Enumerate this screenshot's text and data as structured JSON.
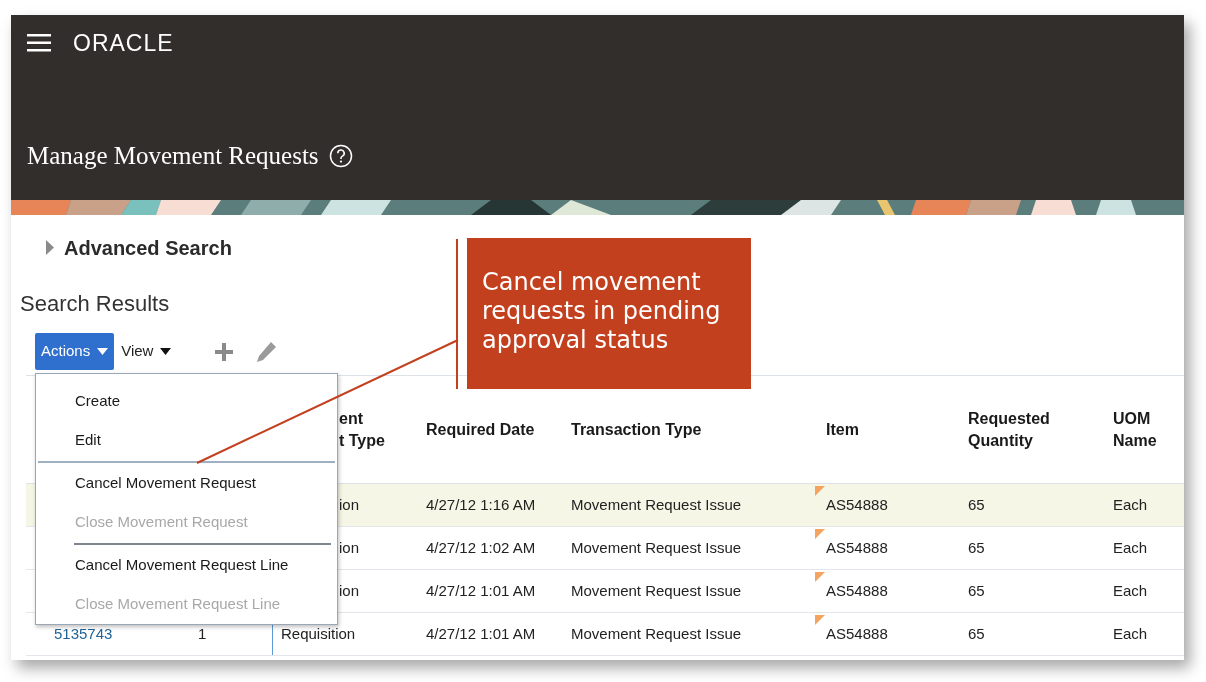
{
  "header": {
    "logo": "ORACLE",
    "page_title": "Manage Movement Requests"
  },
  "advanced_search": {
    "label": "Advanced Search",
    "expanded": false
  },
  "results": {
    "title": "Search Results",
    "actions_button": "Actions",
    "view_button": "View"
  },
  "actions_menu": {
    "items": [
      {
        "kind": "item",
        "label": "Create",
        "disabled": false
      },
      {
        "kind": "item",
        "label": "Edit",
        "disabled": false
      },
      {
        "kind": "separator",
        "inset": false
      },
      {
        "kind": "item",
        "label": "Cancel Movement Request",
        "disabled": false
      },
      {
        "kind": "item",
        "label": "Close Movement Request",
        "disabled": true
      },
      {
        "kind": "separator",
        "inset": true
      },
      {
        "kind": "item",
        "label": "Cancel Movement Request Line",
        "disabled": false
      },
      {
        "kind": "item",
        "label": "Close Movement Request Line",
        "disabled": true
      }
    ]
  },
  "table": {
    "columns": [
      {
        "label": "ent\nt Type"
      },
      {
        "label": "Required Date"
      },
      {
        "label": "Transaction Type"
      },
      {
        "label": "Item"
      },
      {
        "label": "Requested Quantity"
      },
      {
        "label": "UOM Name"
      }
    ],
    "rows": [
      {
        "selected": true,
        "item_flagged": true,
        "cells": [
          "ion",
          "4/27/12 1:16 AM",
          "Movement Request Issue",
          "AS54888",
          "65",
          "Each"
        ]
      },
      {
        "selected": false,
        "item_flagged": true,
        "cells": [
          "ion",
          "4/27/12 1:02 AM",
          "Movement Request Issue",
          "AS54888",
          "65",
          "Each"
        ]
      },
      {
        "selected": false,
        "item_flagged": true,
        "cells": [
          "ion",
          "4/27/12 1:01 AM",
          "Movement Request Issue",
          "AS54888",
          "65",
          "Each"
        ]
      },
      {
        "selected": false,
        "item_flagged": true,
        "leading_cells": [
          "5135743",
          "1"
        ],
        "cells": [
          "Requisition",
          "4/27/12 1:01 AM",
          "Movement Request Issue",
          "AS54888",
          "65",
          "Each"
        ]
      }
    ]
  },
  "callout": {
    "text": "Cancel movement requests in pending approval status"
  }
}
